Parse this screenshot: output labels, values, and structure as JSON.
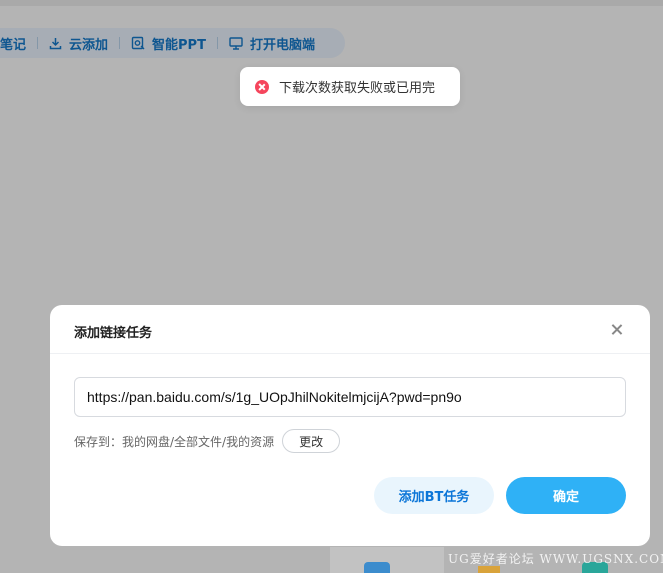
{
  "toolbar": {
    "items": [
      {
        "label": "笔记",
        "icon": "note-icon"
      },
      {
        "label": "云添加",
        "icon": "download-icon"
      },
      {
        "label": "智能PPT",
        "icon": "ppt-icon"
      },
      {
        "label": "打开电脑端",
        "icon": "monitor-icon"
      }
    ]
  },
  "toast": {
    "icon": "error-icon",
    "message": "下载次数获取失败或已用完",
    "color": "#f5455c"
  },
  "dialog": {
    "title": "添加链接任务",
    "url_value": "https://pan.baidu.com/s/1g_UOpJhilNokitelmjcijA?pwd=pn9o",
    "save_label": "保存到：",
    "save_path": "我的网盘/全部文件/我的资源",
    "change_label": "更改",
    "bt_button": "添加BT任务",
    "confirm_button": "确定",
    "accent_color": "#2fb1f6"
  },
  "watermark": "UG爱好者论坛 WWW.UGSNX.COM"
}
